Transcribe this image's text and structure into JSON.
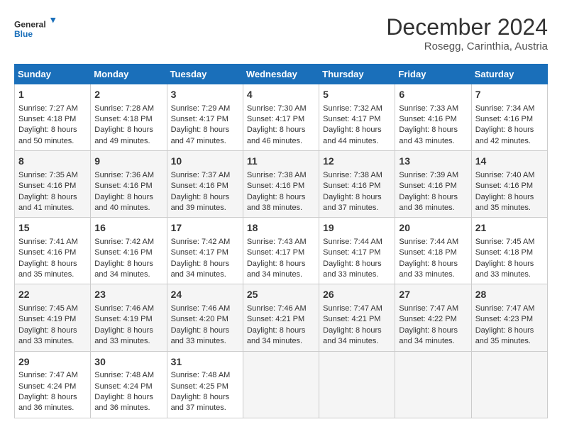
{
  "logo": {
    "line1": "General",
    "line2": "Blue"
  },
  "title": "December 2024",
  "subtitle": "Rosegg, Carinthia, Austria",
  "days_header": [
    "Sunday",
    "Monday",
    "Tuesday",
    "Wednesday",
    "Thursday",
    "Friday",
    "Saturday"
  ],
  "weeks": [
    [
      {
        "day": "1",
        "sunrise": "Sunrise: 7:27 AM",
        "sunset": "Sunset: 4:18 PM",
        "daylight": "Daylight: 8 hours and 50 minutes."
      },
      {
        "day": "2",
        "sunrise": "Sunrise: 7:28 AM",
        "sunset": "Sunset: 4:18 PM",
        "daylight": "Daylight: 8 hours and 49 minutes."
      },
      {
        "day": "3",
        "sunrise": "Sunrise: 7:29 AM",
        "sunset": "Sunset: 4:17 PM",
        "daylight": "Daylight: 8 hours and 47 minutes."
      },
      {
        "day": "4",
        "sunrise": "Sunrise: 7:30 AM",
        "sunset": "Sunset: 4:17 PM",
        "daylight": "Daylight: 8 hours and 46 minutes."
      },
      {
        "day": "5",
        "sunrise": "Sunrise: 7:32 AM",
        "sunset": "Sunset: 4:17 PM",
        "daylight": "Daylight: 8 hours and 44 minutes."
      },
      {
        "day": "6",
        "sunrise": "Sunrise: 7:33 AM",
        "sunset": "Sunset: 4:16 PM",
        "daylight": "Daylight: 8 hours and 43 minutes."
      },
      {
        "day": "7",
        "sunrise": "Sunrise: 7:34 AM",
        "sunset": "Sunset: 4:16 PM",
        "daylight": "Daylight: 8 hours and 42 minutes."
      }
    ],
    [
      {
        "day": "8",
        "sunrise": "Sunrise: 7:35 AM",
        "sunset": "Sunset: 4:16 PM",
        "daylight": "Daylight: 8 hours and 41 minutes."
      },
      {
        "day": "9",
        "sunrise": "Sunrise: 7:36 AM",
        "sunset": "Sunset: 4:16 PM",
        "daylight": "Daylight: 8 hours and 40 minutes."
      },
      {
        "day": "10",
        "sunrise": "Sunrise: 7:37 AM",
        "sunset": "Sunset: 4:16 PM",
        "daylight": "Daylight: 8 hours and 39 minutes."
      },
      {
        "day": "11",
        "sunrise": "Sunrise: 7:38 AM",
        "sunset": "Sunset: 4:16 PM",
        "daylight": "Daylight: 8 hours and 38 minutes."
      },
      {
        "day": "12",
        "sunrise": "Sunrise: 7:38 AM",
        "sunset": "Sunset: 4:16 PM",
        "daylight": "Daylight: 8 hours and 37 minutes."
      },
      {
        "day": "13",
        "sunrise": "Sunrise: 7:39 AM",
        "sunset": "Sunset: 4:16 PM",
        "daylight": "Daylight: 8 hours and 36 minutes."
      },
      {
        "day": "14",
        "sunrise": "Sunrise: 7:40 AM",
        "sunset": "Sunset: 4:16 PM",
        "daylight": "Daylight: 8 hours and 35 minutes."
      }
    ],
    [
      {
        "day": "15",
        "sunrise": "Sunrise: 7:41 AM",
        "sunset": "Sunset: 4:16 PM",
        "daylight": "Daylight: 8 hours and 35 minutes."
      },
      {
        "day": "16",
        "sunrise": "Sunrise: 7:42 AM",
        "sunset": "Sunset: 4:16 PM",
        "daylight": "Daylight: 8 hours and 34 minutes."
      },
      {
        "day": "17",
        "sunrise": "Sunrise: 7:42 AM",
        "sunset": "Sunset: 4:17 PM",
        "daylight": "Daylight: 8 hours and 34 minutes."
      },
      {
        "day": "18",
        "sunrise": "Sunrise: 7:43 AM",
        "sunset": "Sunset: 4:17 PM",
        "daylight": "Daylight: 8 hours and 34 minutes."
      },
      {
        "day": "19",
        "sunrise": "Sunrise: 7:44 AM",
        "sunset": "Sunset: 4:17 PM",
        "daylight": "Daylight: 8 hours and 33 minutes."
      },
      {
        "day": "20",
        "sunrise": "Sunrise: 7:44 AM",
        "sunset": "Sunset: 4:18 PM",
        "daylight": "Daylight: 8 hours and 33 minutes."
      },
      {
        "day": "21",
        "sunrise": "Sunrise: 7:45 AM",
        "sunset": "Sunset: 4:18 PM",
        "daylight": "Daylight: 8 hours and 33 minutes."
      }
    ],
    [
      {
        "day": "22",
        "sunrise": "Sunrise: 7:45 AM",
        "sunset": "Sunset: 4:19 PM",
        "daylight": "Daylight: 8 hours and 33 minutes."
      },
      {
        "day": "23",
        "sunrise": "Sunrise: 7:46 AM",
        "sunset": "Sunset: 4:19 PM",
        "daylight": "Daylight: 8 hours and 33 minutes."
      },
      {
        "day": "24",
        "sunrise": "Sunrise: 7:46 AM",
        "sunset": "Sunset: 4:20 PM",
        "daylight": "Daylight: 8 hours and 33 minutes."
      },
      {
        "day": "25",
        "sunrise": "Sunrise: 7:46 AM",
        "sunset": "Sunset: 4:21 PM",
        "daylight": "Daylight: 8 hours and 34 minutes."
      },
      {
        "day": "26",
        "sunrise": "Sunrise: 7:47 AM",
        "sunset": "Sunset: 4:21 PM",
        "daylight": "Daylight: 8 hours and 34 minutes."
      },
      {
        "day": "27",
        "sunrise": "Sunrise: 7:47 AM",
        "sunset": "Sunset: 4:22 PM",
        "daylight": "Daylight: 8 hours and 34 minutes."
      },
      {
        "day": "28",
        "sunrise": "Sunrise: 7:47 AM",
        "sunset": "Sunset: 4:23 PM",
        "daylight": "Daylight: 8 hours and 35 minutes."
      }
    ],
    [
      {
        "day": "29",
        "sunrise": "Sunrise: 7:47 AM",
        "sunset": "Sunset: 4:24 PM",
        "daylight": "Daylight: 8 hours and 36 minutes."
      },
      {
        "day": "30",
        "sunrise": "Sunrise: 7:48 AM",
        "sunset": "Sunset: 4:24 PM",
        "daylight": "Daylight: 8 hours and 36 minutes."
      },
      {
        "day": "31",
        "sunrise": "Sunrise: 7:48 AM",
        "sunset": "Sunset: 4:25 PM",
        "daylight": "Daylight: 8 hours and 37 minutes."
      },
      null,
      null,
      null,
      null
    ]
  ]
}
